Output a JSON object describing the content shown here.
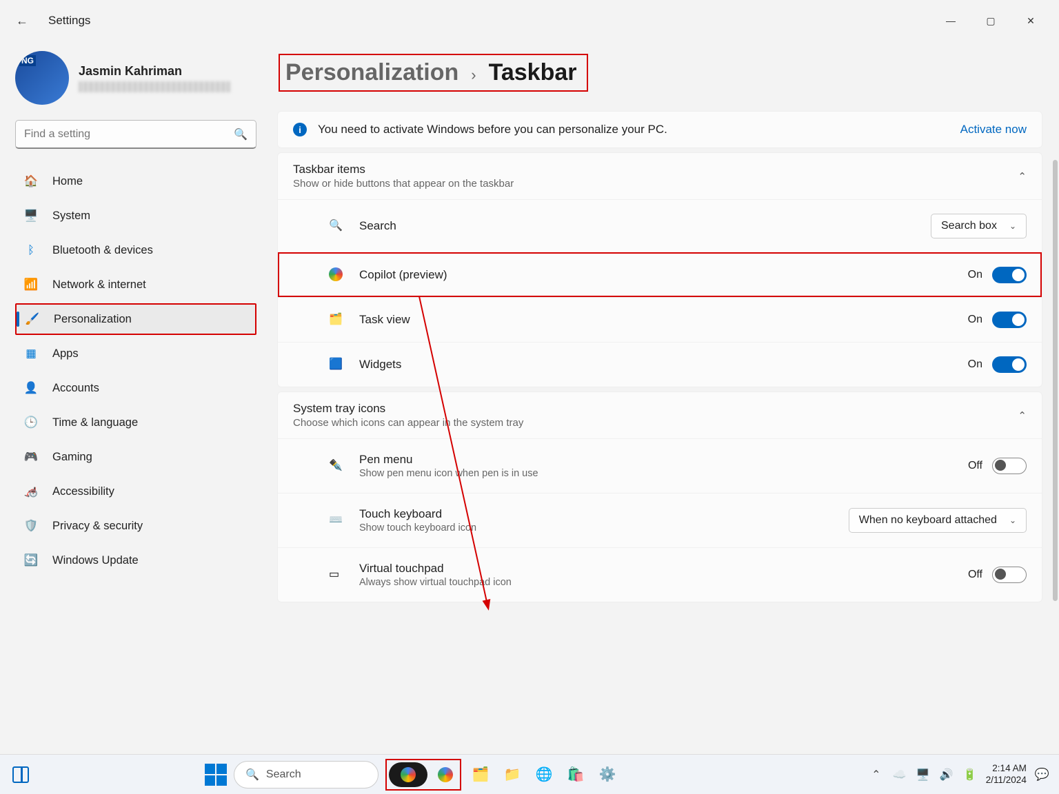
{
  "window": {
    "title": "Settings"
  },
  "user": {
    "name": "Jasmin Kahriman"
  },
  "search": {
    "placeholder": "Find a setting"
  },
  "sidebar": {
    "items": [
      {
        "label": "Home"
      },
      {
        "label": "System"
      },
      {
        "label": "Bluetooth & devices"
      },
      {
        "label": "Network & internet"
      },
      {
        "label": "Personalization"
      },
      {
        "label": "Apps"
      },
      {
        "label": "Accounts"
      },
      {
        "label": "Time & language"
      },
      {
        "label": "Gaming"
      },
      {
        "label": "Accessibility"
      },
      {
        "label": "Privacy & security"
      },
      {
        "label": "Windows Update"
      }
    ]
  },
  "breadcrumb": {
    "parent": "Personalization",
    "current": "Taskbar"
  },
  "banner": {
    "message": "You need to activate Windows before you can personalize your PC.",
    "action": "Activate now"
  },
  "sections": {
    "taskbarItems": {
      "title": "Taskbar items",
      "subtitle": "Show or hide buttons that appear on the taskbar",
      "rows": {
        "search": {
          "label": "Search",
          "dropdown": "Search box"
        },
        "copilot": {
          "label": "Copilot (preview)",
          "state": "On"
        },
        "taskview": {
          "label": "Task view",
          "state": "On"
        },
        "widgets": {
          "label": "Widgets",
          "state": "On"
        }
      }
    },
    "systemTray": {
      "title": "System tray icons",
      "subtitle": "Choose which icons can appear in the system tray",
      "rows": {
        "pen": {
          "label": "Pen menu",
          "sub": "Show pen menu icon when pen is in use",
          "state": "Off"
        },
        "touchkb": {
          "label": "Touch keyboard",
          "sub": "Show touch keyboard icon",
          "dropdown": "When no keyboard attached"
        },
        "vtouch": {
          "label": "Virtual touchpad",
          "sub": "Always show virtual touchpad icon",
          "state": "Off"
        }
      }
    }
  },
  "taskbar": {
    "search": "Search",
    "clock": {
      "time": "2:14 AM",
      "date": "2/11/2024"
    }
  }
}
